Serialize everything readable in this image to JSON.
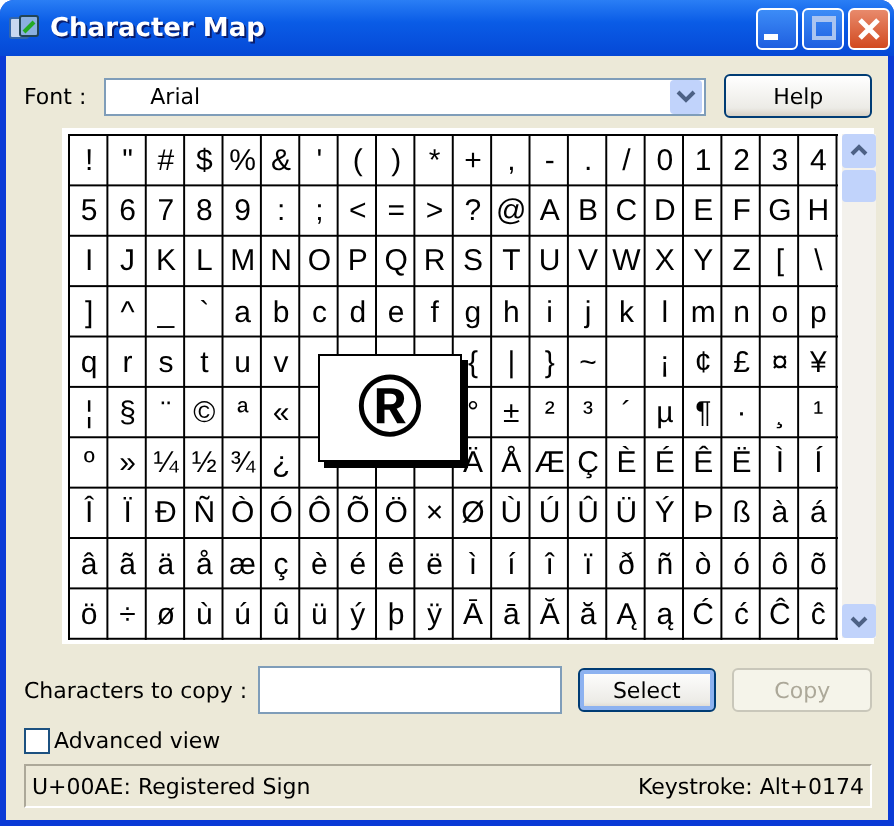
{
  "window": {
    "title": "Character Map"
  },
  "font": {
    "label": "Font :",
    "value": "Arial"
  },
  "help_button": {
    "label": "Help"
  },
  "grid": {
    "rows": [
      [
        "!",
        "\"",
        "#",
        "$",
        "%",
        "&",
        "'",
        "(",
        ")",
        "*",
        "+",
        ",",
        "-",
        ".",
        "/",
        "0",
        "1",
        "2",
        "3",
        "4"
      ],
      [
        "5",
        "6",
        "7",
        "8",
        "9",
        ":",
        ";",
        "<",
        "=",
        ">",
        "?",
        "@",
        "A",
        "B",
        "C",
        "D",
        "E",
        "F",
        "G",
        "H"
      ],
      [
        "I",
        "J",
        "K",
        "L",
        "M",
        "N",
        "O",
        "P",
        "Q",
        "R",
        "S",
        "T",
        "U",
        "V",
        "W",
        "X",
        "Y",
        "Z",
        "[",
        "\\"
      ],
      [
        "]",
        "^",
        "_",
        "`",
        "a",
        "b",
        "c",
        "d",
        "e",
        "f",
        "g",
        "h",
        "i",
        "j",
        "k",
        "l",
        "m",
        "n",
        "o",
        "p"
      ],
      [
        "q",
        "r",
        "s",
        "t",
        "u",
        "v",
        null,
        null,
        null,
        null,
        "{",
        "|",
        "}",
        "~",
        null,
        "¡",
        "¢",
        "£",
        "¤",
        "¥"
      ],
      [
        "¦",
        "§",
        "¨",
        "©",
        "ª",
        "«",
        null,
        null,
        null,
        null,
        "°",
        "±",
        "²",
        "³",
        "´",
        "µ",
        "¶",
        "·",
        "¸",
        "¹"
      ],
      [
        "º",
        "»",
        "¼",
        "½",
        "¾",
        "¿",
        null,
        null,
        null,
        null,
        "Ä",
        "Å",
        "Æ",
        "Ç",
        "È",
        "É",
        "Ê",
        "Ë",
        "Ì",
        "Í"
      ],
      [
        "Î",
        "Ï",
        "Ð",
        "Ñ",
        "Ò",
        "Ó",
        "Ô",
        "Õ",
        "Ö",
        "×",
        "Ø",
        "Ù",
        "Ú",
        "Û",
        "Ü",
        "Ý",
        "Þ",
        "ß",
        "à",
        "á"
      ],
      [
        "â",
        "ã",
        "ä",
        "å",
        "æ",
        "ç",
        "è",
        "é",
        "ê",
        "ë",
        "ì",
        "í",
        "î",
        "ï",
        "ð",
        "ñ",
        "ò",
        "ó",
        "ô",
        "õ"
      ],
      [
        "ö",
        "÷",
        "ø",
        "ù",
        "ú",
        "û",
        "ü",
        "ý",
        "þ",
        "ÿ",
        "Ā",
        "ā",
        "Ă",
        "ă",
        "Ą",
        "ą",
        "Ć",
        "ć",
        "Ĉ",
        "ĉ"
      ]
    ],
    "magnified": "®"
  },
  "copy_row": {
    "label": "Characters to copy :",
    "select_button": {
      "label": "Select",
      "disabled": false
    },
    "copy_button": {
      "label": "Copy",
      "disabled": true
    }
  },
  "advanced_view": {
    "label": "Advanced view",
    "checked": false
  },
  "status_bar": {
    "character": "U+00AE: Registered Sign",
    "keystroke": "Keystroke: Alt+0174"
  }
}
